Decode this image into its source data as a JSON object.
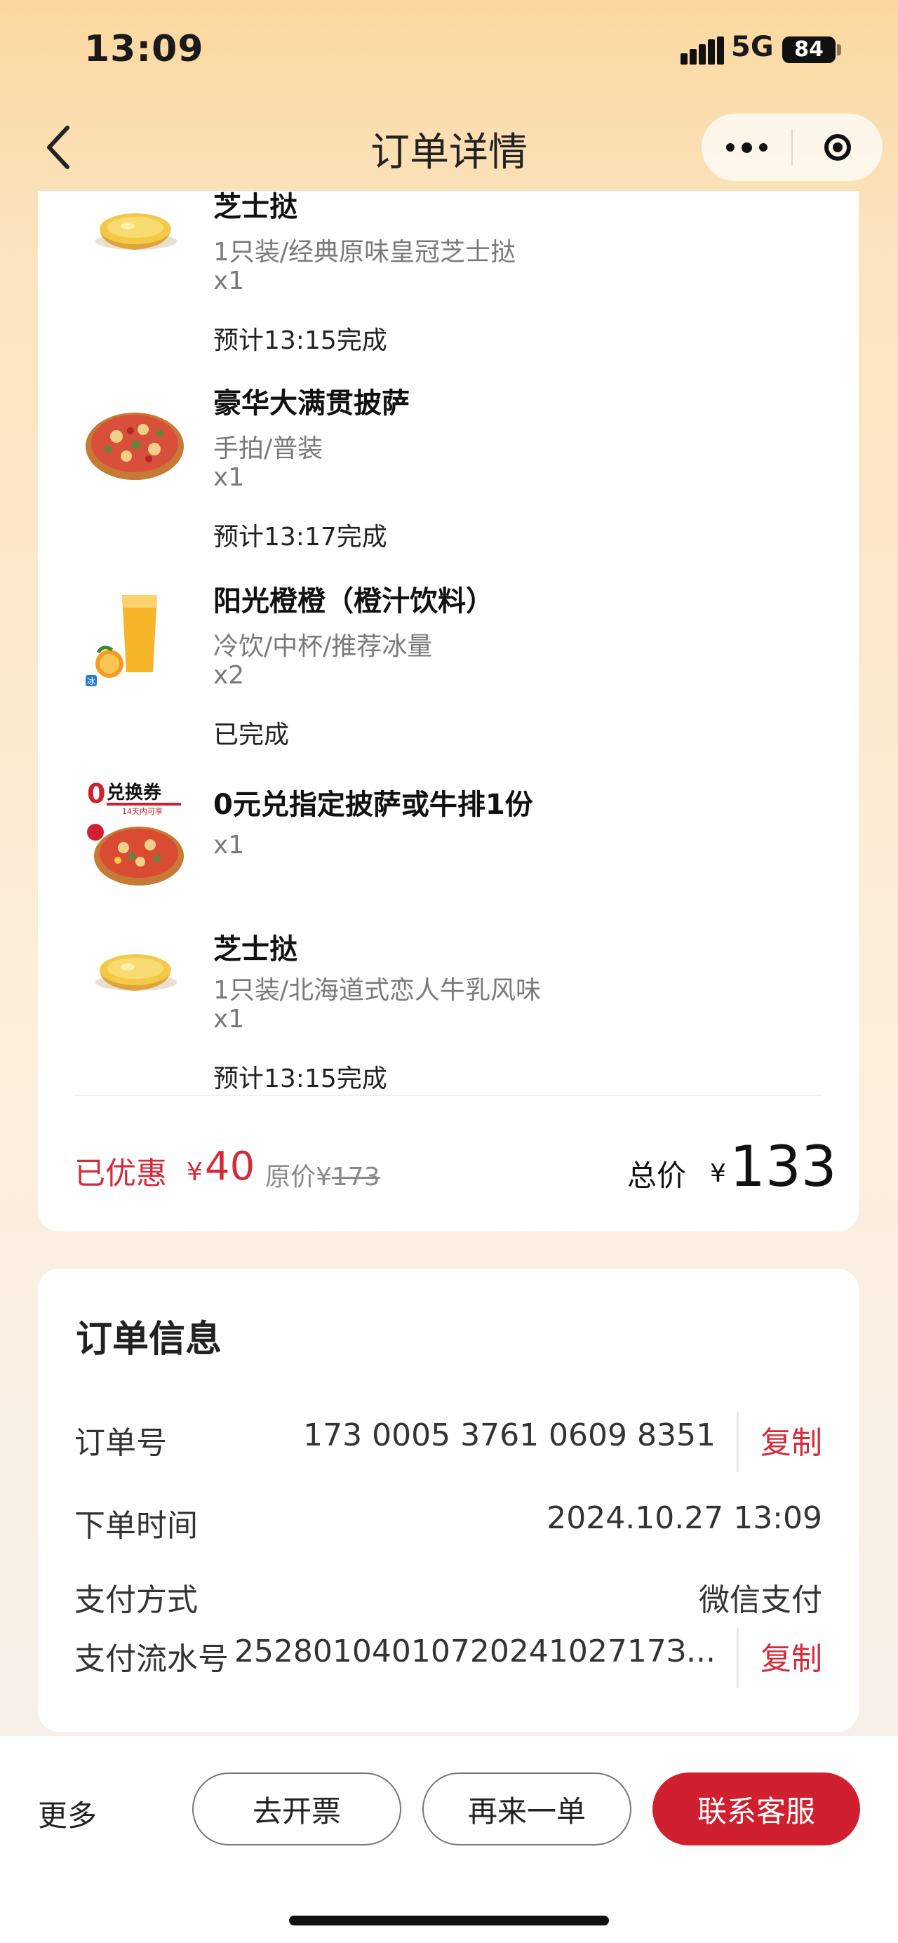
{
  "status": {
    "time": "13:09",
    "network": "5G",
    "battery": "84"
  },
  "nav": {
    "title": "订单详情"
  },
  "items": [
    {
      "name": "芝士挞",
      "spec": "1只装/经典原味皇冠芝士挞",
      "qty": "x1",
      "status": "预计13:15完成",
      "thumb": "egg-tart"
    },
    {
      "name": "豪华大满贯披萨",
      "spec": "手拍/普装",
      "qty": "x1",
      "status": "预计13:17完成",
      "thumb": "pizza"
    },
    {
      "name": "阳光橙橙（橙汁饮料）",
      "spec": "冷饮/中杯/推荐冰量",
      "qty": "x2",
      "status": "已完成",
      "thumb": "orange-juice",
      "thumb_badge": "冰"
    },
    {
      "name": "0元兑指定披萨或牛排1份",
      "qty": "x1",
      "thumb": "voucher-pizza",
      "thumb_badge": "0",
      "thumb_title": "兑换券",
      "thumb_sub": "14天内可享"
    },
    {
      "name": "芝士挞",
      "spec": "1只装/北海道式恋人牛乳风味",
      "qty": "x1",
      "status": "预计13:15完成",
      "thumb": "egg-tart"
    }
  ],
  "summary": {
    "discount_label": "已优惠",
    "currency": "¥",
    "discount_amount": "40",
    "original_label": "原价¥",
    "original_amount": "173",
    "total_label": "总价",
    "total_amount": "133"
  },
  "order_info": {
    "title": "订单信息",
    "order_no_label": "订单号",
    "order_no": "173 0005 3761 0609 8351",
    "copy_label": "复制",
    "time_label": "下单时间",
    "time": "2024.10.27 13:09",
    "pay_label": "支付方式",
    "pay_method": "微信支付",
    "serial_label": "支付流水号",
    "serial": "2528010401072024102717З..."
  },
  "actions": {
    "more": "更多",
    "invoice": "去开票",
    "reorder": "再来一单",
    "contact": "联系客服"
  },
  "colors": {
    "accent": "#d0202f",
    "price_red": "#d42b3a",
    "bg_top": "#fbd8a0"
  }
}
